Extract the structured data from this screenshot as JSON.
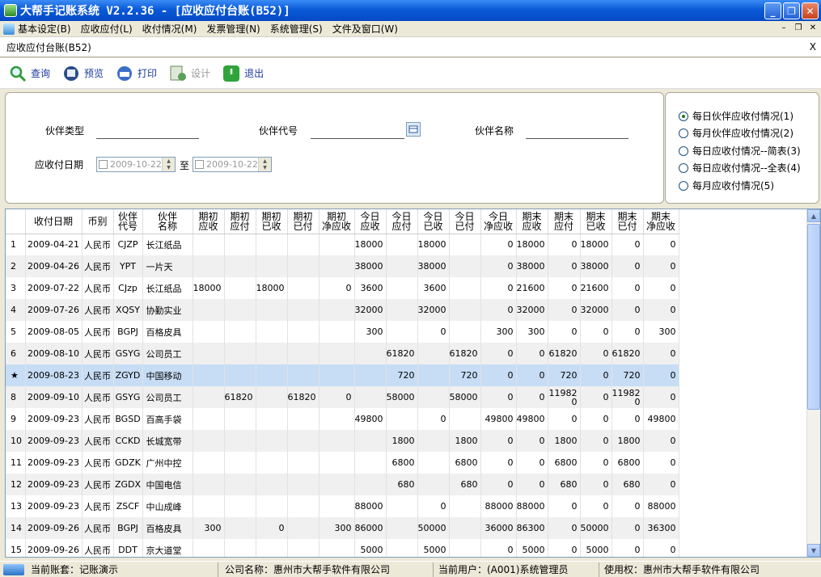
{
  "window": {
    "title": "大帮手记账系统 V2.2.36 - [应收应付台账(B52)]"
  },
  "menu": [
    "基本设定(B)",
    "应收应付(L)",
    "收付情况(M)",
    "发票管理(N)",
    "系统管理(S)",
    "文件及窗口(W)"
  ],
  "subtitle": "应收应付台账(B52)",
  "subtitle_close": "X",
  "toolbar": {
    "query": "查询",
    "preview": "预览",
    "print": "打印",
    "design": "设计",
    "exit": "退出"
  },
  "filter": {
    "partner_type_label": "伙伴类型",
    "partner_code_label": "伙伴代号",
    "partner_name_label": "伙伴名称",
    "date_label": "应收付日期",
    "date_from": "2009-10-22",
    "to_label": "至",
    "date_to": "2009-10-22"
  },
  "options": [
    "每日伙伴应收付情况(1)",
    "每月伙伴应收付情况(2)",
    "每日应收付情况--简表(3)",
    "每日应收付情况--全表(4)",
    "每月应收付情况(5)"
  ],
  "selected_option": 0,
  "columns": [
    "",
    "收付日期",
    "币别",
    "伙伴代号",
    "伙伴名称",
    "期初应收",
    "期初应付",
    "期初已收",
    "期初已付",
    "期初净应收",
    "今日应收",
    "今日应付",
    "今日已收",
    "今日已付",
    "今日净应收",
    "期末应收",
    "期末应付",
    "期末已收",
    "期末已付",
    "期末净应收"
  ],
  "rows": [
    [
      "1",
      "2009-04-21",
      "人民币",
      "CJZP",
      "长江纸品",
      "",
      "",
      "",
      "",
      "",
      "18000",
      "",
      "18000",
      "",
      "0",
      "18000",
      "0",
      "18000",
      "0",
      "0"
    ],
    [
      "2",
      "2009-04-26",
      "人民币",
      "YPT",
      "一片天",
      "",
      "",
      "",
      "",
      "",
      "38000",
      "",
      "38000",
      "",
      "0",
      "38000",
      "0",
      "38000",
      "0",
      "0"
    ],
    [
      "3",
      "2009-07-22",
      "人民币",
      "CJzp",
      "长江纸品",
      "18000",
      "",
      "18000",
      "",
      "0",
      "3600",
      "",
      "3600",
      "",
      "0",
      "21600",
      "0",
      "21600",
      "0",
      "0"
    ],
    [
      "4",
      "2009-07-26",
      "人民币",
      "XQSY",
      "协勤实业",
      "",
      "",
      "",
      "",
      "",
      "32000",
      "",
      "32000",
      "",
      "0",
      "32000",
      "0",
      "32000",
      "0",
      "0"
    ],
    [
      "5",
      "2009-08-05",
      "人民币",
      "BGPJ",
      "百格皮具",
      "",
      "",
      "",
      "",
      "",
      "300",
      "",
      "0",
      "",
      "300",
      "300",
      "0",
      "0",
      "0",
      "300"
    ],
    [
      "6",
      "2009-08-10",
      "人民币",
      "GSYG",
      "公司员工",
      "",
      "",
      "",
      "",
      "",
      "",
      "61820",
      "",
      "61820",
      "0",
      "0",
      "61820",
      "0",
      "61820",
      "0"
    ],
    [
      "★",
      "2009-08-23",
      "人民币",
      "ZGYD",
      "中国移动",
      "",
      "",
      "",
      "",
      "",
      "",
      "720",
      "",
      "720",
      "0",
      "0",
      "720",
      "0",
      "720",
      "0"
    ],
    [
      "8",
      "2009-09-10",
      "人民币",
      "GSYG",
      "公司员工",
      "",
      "61820",
      "",
      "61820",
      "0",
      "",
      "58000",
      "",
      "58000",
      "0",
      "0",
      "119820",
      "0",
      "119820",
      "0"
    ],
    [
      "9",
      "2009-09-23",
      "人民币",
      "BGSD",
      "百高手袋",
      "",
      "",
      "",
      "",
      "",
      "49800",
      "",
      "0",
      "",
      "49800",
      "49800",
      "0",
      "0",
      "0",
      "49800"
    ],
    [
      "10",
      "2009-09-23",
      "人民币",
      "CCKD",
      "长城宽带",
      "",
      "",
      "",
      "",
      "",
      "",
      "1800",
      "",
      "1800",
      "0",
      "0",
      "1800",
      "0",
      "1800",
      "0"
    ],
    [
      "11",
      "2009-09-23",
      "人民币",
      "GDZK",
      "广州中控",
      "",
      "",
      "",
      "",
      "",
      "",
      "6800",
      "",
      "6800",
      "0",
      "0",
      "6800",
      "0",
      "6800",
      "0"
    ],
    [
      "12",
      "2009-09-23",
      "人民币",
      "ZGDX",
      "中国电信",
      "",
      "",
      "",
      "",
      "",
      "",
      "680",
      "",
      "680",
      "0",
      "0",
      "680",
      "0",
      "680",
      "0"
    ],
    [
      "13",
      "2009-09-23",
      "人民币",
      "ZSCF",
      "中山成峰",
      "",
      "",
      "",
      "",
      "",
      "88000",
      "",
      "0",
      "",
      "88000",
      "88000",
      "0",
      "0",
      "0",
      "88000"
    ],
    [
      "14",
      "2009-09-26",
      "人民币",
      "BGPJ",
      "百格皮具",
      "300",
      "",
      "0",
      "",
      "300",
      "86000",
      "",
      "50000",
      "",
      "36000",
      "86300",
      "0",
      "50000",
      "0",
      "36300"
    ],
    [
      "15",
      "2009-09-26",
      "人民币",
      "DDT",
      "京大道堂",
      "",
      "",
      "",
      "",
      "",
      "5000",
      "",
      "5000",
      "",
      "0",
      "5000",
      "0",
      "5000",
      "0",
      "0"
    ]
  ],
  "status": {
    "account": "当前账套：记账演示",
    "company": "公司名称：惠州市大帮手软件有限公司",
    "user": "当前用户：(A001)系统管理员",
    "license": "使用权：惠州市大帮手软件有限公司"
  }
}
